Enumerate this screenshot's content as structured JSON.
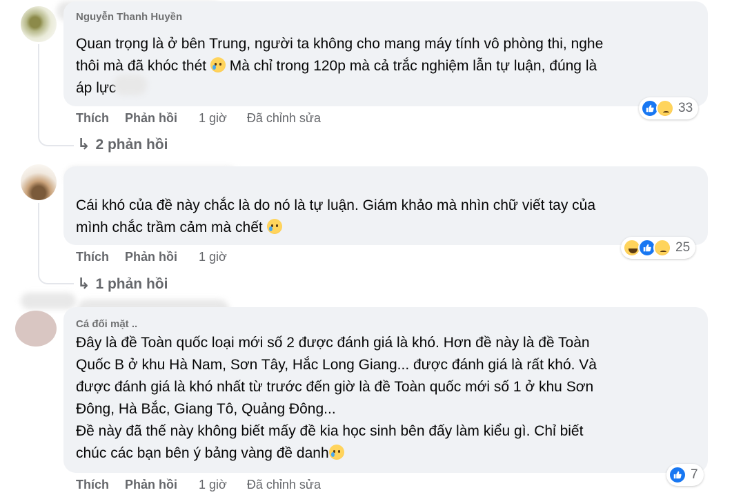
{
  "comments": [
    {
      "author": "Nguyễn Thanh Huyền",
      "text": "Quan trọng là ở bên Trung, người ta không cho mang máy tính vô phòng thi, nghe\nthôi mà đã khóc thét",
      "text_after_emoji": " Mà chỉ trong 120p mà cả trắc nghiệm lẫn tự luận, đúng là\náp lực",
      "actions": {
        "like": "Thích",
        "reply": "Phản hồi",
        "time": "1 giờ",
        "edited": "Đã chỉnh sửa"
      },
      "reaction_count": "33",
      "reaction_icons": [
        "like-icon",
        "sad-icon"
      ],
      "replies_label": "2 phản hồi"
    },
    {
      "author": "",
      "text": "Cái khó của đề này chắc là do nó là tự luận. Giám khảo mà nhìn chữ viết tay của\nmình chắc trầm cảm mà chết ",
      "actions": {
        "like": "Thích",
        "reply": "Phản hồi",
        "time": "1 giờ"
      },
      "reaction_count": "25",
      "reaction_icons": [
        "haha-icon",
        "like-icon",
        "sad-icon"
      ],
      "replies_label": "1 phản hồi"
    },
    {
      "author": "Cá đối mặt ..",
      "text": "Đây là đề Toàn quốc loại mới số 2 được đánh giá là khó. Hơn đề này là đề Toàn\nQuốc B ở khu Hà Nam, Sơn Tây, Hắc Long Giang... được đánh giá là rất khó. Và\nđược đánh giá là khó nhất từ trước đến giờ là đề Toàn quốc mới số 1 ở khu Sơn\nĐông, Hà Bắc, Giang Tô, Quảng Đông...\nĐề này đã thế này không biết mấy đề kia học sinh bên đấy làm kiểu gì. Chỉ biết\nchúc các bạn bên ý bảng vàng đề danh",
      "actions": {
        "like": "Thích",
        "reply": "Phản hồi",
        "time": "1 giờ",
        "edited": "Đã chỉnh sửa"
      },
      "reaction_count": "7",
      "reaction_icons": [
        "like-icon"
      ]
    }
  ],
  "colors": {
    "bubble": "#f0f2f5",
    "meta": "#65676b",
    "like_blue": "#1877f2"
  }
}
